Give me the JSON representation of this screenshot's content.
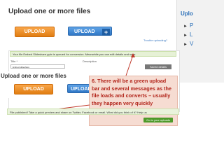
{
  "top": {
    "title": "Upload one or more files",
    "upload_primary": "UPLOAD",
    "upload_secondary": "UPLOAD",
    "plus": "+",
    "trouble_link": "Trouble uploading?"
  },
  "sidebar": {
    "heading": "Uplo",
    "items": [
      {
        "label": "P"
      },
      {
        "label": "L"
      },
      {
        "label": "V"
      }
    ]
  },
  "middle": {
    "status_text": "Your file Embed Slideshare.pptx is queued for conversion. Meanwhile you can edit details and save",
    "title_label": "Title *",
    "title_value": "Embed slideshare",
    "description_label": "Description",
    "saved_button": "Saved details"
  },
  "overlay": {
    "title": "Upload one or more files",
    "upload_primary": "UPLOAD",
    "upload_secondary": "UPLOAD"
  },
  "callout": {
    "text": "6. There will be a green upload bar and several messages as the file loads and converts – usually they happen very quickly"
  },
  "bottom": {
    "text": "File published! Take a quick preview and share on Twitter, Facebook or email. What did you think of it? Help us",
    "button": "Go to your uploads"
  },
  "colors": {
    "orange": "#e07d12",
    "blue": "#2f77c6",
    "callout_text": "#b2241a",
    "callout_bg": "#f6dcd2",
    "green_bar": "#e9f3dc",
    "arrow": "#c0392b"
  }
}
